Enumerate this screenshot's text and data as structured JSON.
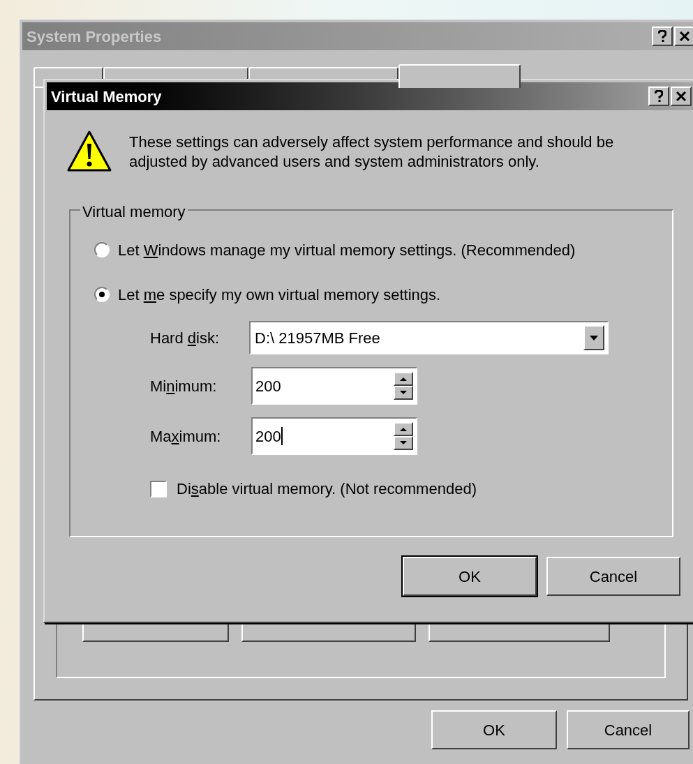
{
  "back_window": {
    "title": "System Properties",
    "active": false,
    "tabs": [
      {
        "selected": false
      },
      {
        "selected": false
      },
      {
        "selected": false
      },
      {
        "selected": true
      }
    ],
    "buttons": [
      "OK",
      "Cancel"
    ]
  },
  "dialog": {
    "title": "Virtual Memory",
    "active": true,
    "warning": "These settings can adversely affect system performance and should be adjusted by advanced users and system administrators only.",
    "group_label": "Virtual memory",
    "options": [
      {
        "label": [
          "Let ",
          "W",
          "indows manage my virtual memory settings. (Recommended)"
        ],
        "selected": false
      },
      {
        "label": [
          "Let ",
          "m",
          "e specify my own virtual memory settings."
        ],
        "selected": true
      }
    ],
    "hard_disk": {
      "label": [
        "Hard ",
        "d",
        "isk:"
      ],
      "value": "D:\\ 21957MB Free"
    },
    "fields": [
      {
        "label": [
          "Mi",
          "n",
          "imum:"
        ],
        "value": "200",
        "focused": false
      },
      {
        "label": [
          "Ma",
          "x",
          "imum:"
        ],
        "value": "200",
        "focused": true
      }
    ],
    "disable": {
      "label": [
        "Di",
        "s",
        "able virtual memory. (Not recommended)"
      ],
      "checked": false
    },
    "buttons": [
      {
        "label": "OK",
        "default": true
      },
      {
        "label": "Cancel",
        "default": false
      }
    ]
  }
}
